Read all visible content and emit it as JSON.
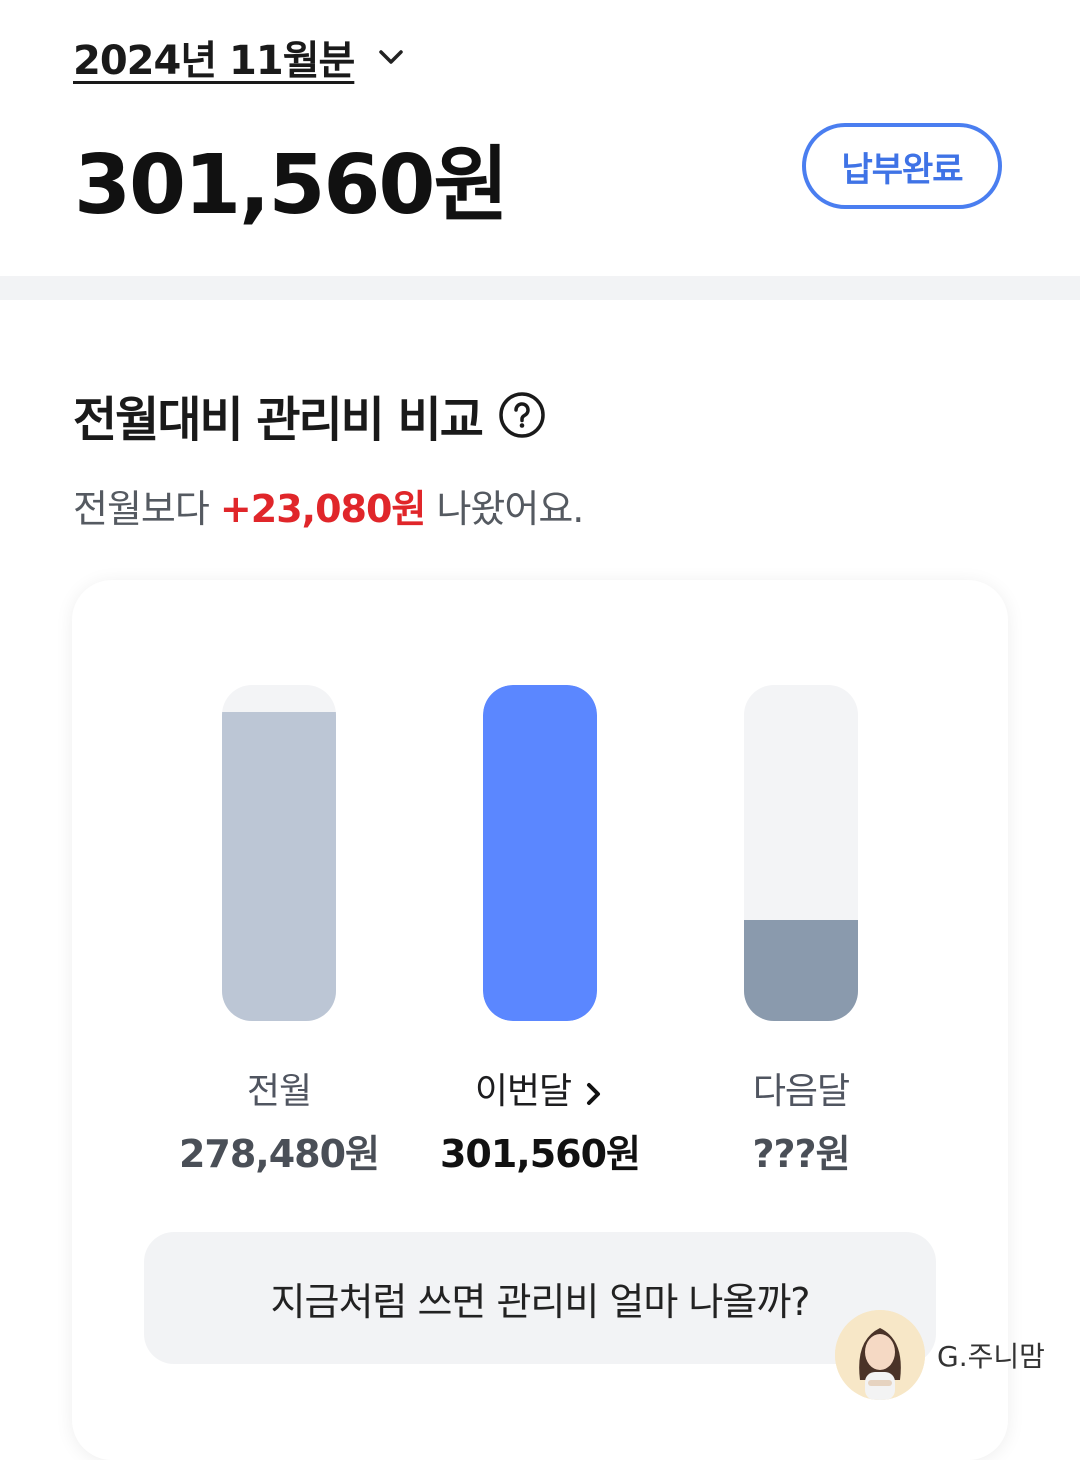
{
  "header": {
    "period_label": "2024년 11월분",
    "amount": "301,560원",
    "paid_badge": "납부완료"
  },
  "comparison": {
    "title": "전월대비 관리비 비교",
    "summary_prefix": "전월보다 ",
    "summary_diff": "+23,080원",
    "summary_suffix": " 나왔어요.",
    "bars": [
      {
        "label": "전월",
        "value": "278,480원",
        "fill_fraction": 0.92
      },
      {
        "label": "이번달",
        "value": "301,560원",
        "fill_fraction": 1.0
      },
      {
        "label": "다음달",
        "value": "???원",
        "fill_fraction": 0.3
      }
    ],
    "forecast_button": "지금처럼 쓰면 관리비 얼마 나올까?"
  },
  "watermark": {
    "text": "G.주니맘"
  },
  "colors": {
    "accent": "#5b87ff",
    "badge_border": "#4a7ef0",
    "diff_red": "#e0262a",
    "prev_bar": "#bcc6d5",
    "next_bar": "#8a9aad"
  }
}
